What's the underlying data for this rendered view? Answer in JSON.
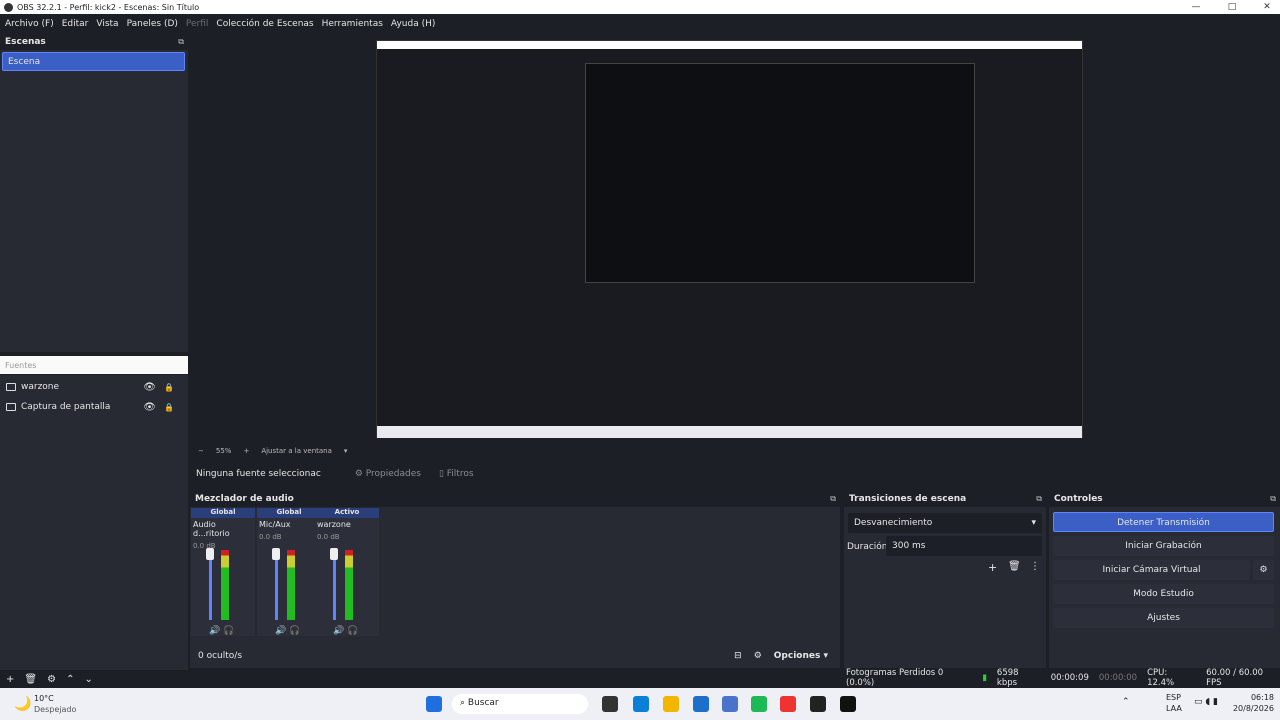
{
  "window": {
    "title": "OBS 32.2.1 - Perfil: kick2 - Escenas: Sin Título"
  },
  "menu": [
    "Archivo (F)",
    "Editar",
    "Vista",
    "Paneles (D)",
    "Perfil",
    "Colección de Escenas",
    "Herramientas",
    "Ayuda (H)"
  ],
  "scenes": {
    "title": "Escenas",
    "items": [
      "Escena"
    ]
  },
  "sources": {
    "title": "Fuentes",
    "items": [
      "warzone",
      "Captura de pantalla"
    ]
  },
  "zoom": {
    "minus": "−",
    "value": "55%",
    "plus": "+",
    "fit": "Ajustar a la ventana"
  },
  "context": {
    "none": "Ninguna fuente seleccionac",
    "props": "Propiedades",
    "filters": "Filtros"
  },
  "mixer": {
    "title": "Mezclador de audio",
    "hidden": "0 oculto/s",
    "options": "Opciones",
    "channels": [
      {
        "tag": "Global",
        "name": "Audio d...ritorio",
        "db": "0.0 dB"
      },
      {
        "tag": "Global",
        "name": "Mic/Aux",
        "db": "0.0 dB"
      },
      {
        "tag": "Activo",
        "name": "warzone",
        "db": "0.0 dB"
      }
    ]
  },
  "transitions": {
    "title": "Transiciones de escena",
    "type": "Desvanecimiento",
    "duration_label": "Duración",
    "duration": "300 ms"
  },
  "controls": {
    "title": "Controles",
    "buttons": [
      "Detener Transmisión",
      "Iniciar Grabación",
      "Iniciar Cámara Virtual",
      "Modo Estudio",
      "Ajustes"
    ]
  },
  "status": {
    "dropped": "Fotogramas Perdidos 0 (0.0%)",
    "kbps": "6598 kbps",
    "stream_time": "00:00:09",
    "rec_time": "00:00:00",
    "cpu": "CPU: 12.4%",
    "fps": "60.00 / 60.00 FPS"
  },
  "taskbar": {
    "temp": "10°C",
    "weather": "Despejado",
    "search": "Buscar",
    "lang1": "ESP",
    "lang2": "LAA",
    "time": "06:18",
    "date": "20/8/2026"
  }
}
